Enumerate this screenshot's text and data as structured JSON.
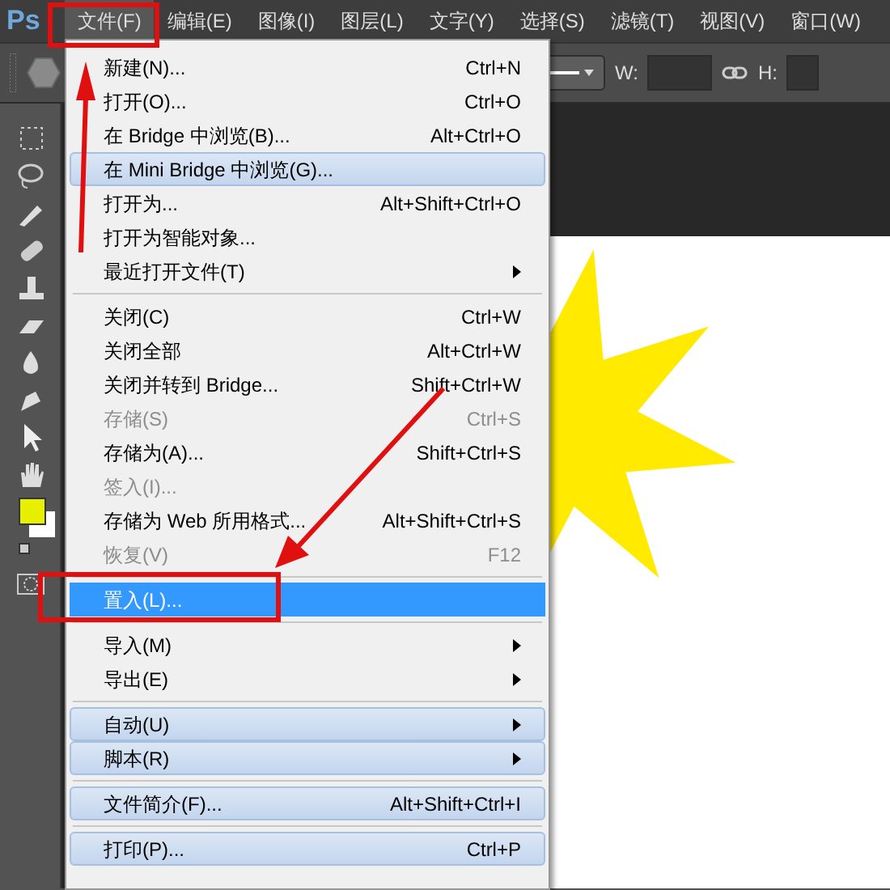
{
  "app": {
    "logo": "Ps"
  },
  "menubar": [
    {
      "label": "文件(F)",
      "selected": true
    },
    {
      "label": "编辑(E)",
      "selected": false
    },
    {
      "label": "图像(I)",
      "selected": false
    },
    {
      "label": "图层(L)",
      "selected": false
    },
    {
      "label": "文字(Y)",
      "selected": false
    },
    {
      "label": "选择(S)",
      "selected": false
    },
    {
      "label": "滤镜(T)",
      "selected": false
    },
    {
      "label": "视图(V)",
      "selected": false
    },
    {
      "label": "窗口(W)",
      "selected": false
    }
  ],
  "options_bar": {
    "width_label": "W:",
    "height_label": "H:"
  },
  "file_menu": [
    {
      "kind": "item",
      "label": "新建(N)...",
      "shortcut": "Ctrl+N",
      "disabled": false,
      "hover": false,
      "selected": false,
      "submenu": false
    },
    {
      "kind": "item",
      "label": "打开(O)...",
      "shortcut": "Ctrl+O",
      "disabled": false,
      "hover": false,
      "selected": false,
      "submenu": false
    },
    {
      "kind": "item",
      "label": "在 Bridge 中浏览(B)...",
      "shortcut": "Alt+Ctrl+O",
      "disabled": false,
      "hover": false,
      "selected": false,
      "submenu": false
    },
    {
      "kind": "item",
      "label": "在 Mini Bridge 中浏览(G)...",
      "disabled": false,
      "hover": true,
      "selected": false,
      "submenu": false
    },
    {
      "kind": "item",
      "label": "打开为...",
      "shortcut": "Alt+Shift+Ctrl+O",
      "disabled": false,
      "hover": false,
      "selected": false,
      "submenu": false
    },
    {
      "kind": "item",
      "label": "打开为智能对象...",
      "disabled": false,
      "hover": false,
      "selected": false,
      "submenu": false
    },
    {
      "kind": "item",
      "label": "最近打开文件(T)",
      "disabled": false,
      "hover": false,
      "selected": false,
      "submenu": true
    },
    {
      "kind": "separator"
    },
    {
      "kind": "item",
      "label": "关闭(C)",
      "shortcut": "Ctrl+W",
      "disabled": false,
      "hover": false,
      "selected": false,
      "submenu": false
    },
    {
      "kind": "item",
      "label": "关闭全部",
      "shortcut": "Alt+Ctrl+W",
      "disabled": false,
      "hover": false,
      "selected": false,
      "submenu": false
    },
    {
      "kind": "item",
      "label": "关闭并转到 Bridge...",
      "shortcut": "Shift+Ctrl+W",
      "disabled": false,
      "hover": false,
      "selected": false,
      "submenu": false
    },
    {
      "kind": "item",
      "label": "存储(S)",
      "shortcut": "Ctrl+S",
      "disabled": true,
      "hover": false,
      "selected": false,
      "submenu": false
    },
    {
      "kind": "item",
      "label": "存储为(A)...",
      "shortcut": "Shift+Ctrl+S",
      "disabled": false,
      "hover": false,
      "selected": false,
      "submenu": false
    },
    {
      "kind": "item",
      "label": "签入(I)...",
      "disabled": true,
      "hover": false,
      "selected": false,
      "submenu": false
    },
    {
      "kind": "item",
      "label": "存储为 Web 所用格式...",
      "shortcut": "Alt+Shift+Ctrl+S",
      "disabled": false,
      "hover": false,
      "selected": false,
      "submenu": false
    },
    {
      "kind": "item",
      "label": "恢复(V)",
      "shortcut": "F12",
      "disabled": true,
      "hover": false,
      "selected": false,
      "submenu": false
    },
    {
      "kind": "separator"
    },
    {
      "kind": "item",
      "label": "置入(L)...",
      "disabled": false,
      "hover": false,
      "selected": true,
      "submenu": false
    },
    {
      "kind": "separator"
    },
    {
      "kind": "item",
      "label": "导入(M)",
      "disabled": false,
      "hover": false,
      "selected": false,
      "submenu": true
    },
    {
      "kind": "item",
      "label": "导出(E)",
      "disabled": false,
      "hover": false,
      "selected": false,
      "submenu": true
    },
    {
      "kind": "separator"
    },
    {
      "kind": "item",
      "label": "自动(U)",
      "disabled": false,
      "hover": true,
      "selected": false,
      "submenu": true
    },
    {
      "kind": "item",
      "label": "脚本(R)",
      "disabled": false,
      "hover": true,
      "selected": false,
      "submenu": true
    },
    {
      "kind": "separator"
    },
    {
      "kind": "item",
      "label": "文件简介(F)...",
      "shortcut": "Alt+Shift+Ctrl+I",
      "disabled": false,
      "hover": true,
      "selected": false,
      "submenu": false
    },
    {
      "kind": "separator"
    },
    {
      "kind": "item",
      "label": "打印(P)...",
      "shortcut": "Ctrl+P",
      "disabled": false,
      "hover": true,
      "selected": false,
      "submenu": false
    }
  ]
}
